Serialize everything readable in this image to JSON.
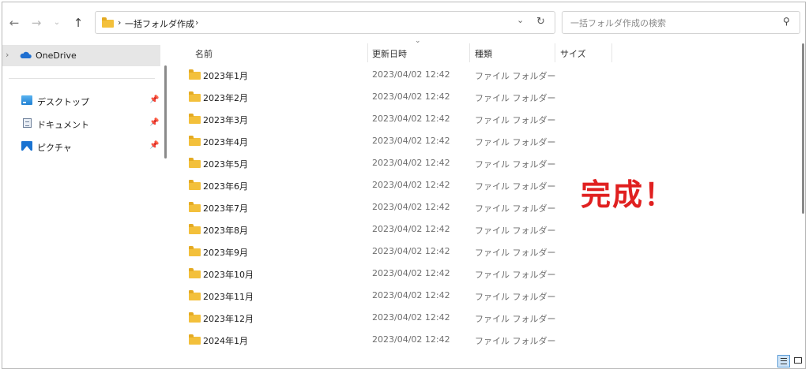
{
  "toolbar": {
    "back_icon": "arrow-left-icon",
    "forward_icon": "arrow-right-icon",
    "recent_icon": "chevron-down-icon",
    "up_icon": "arrow-up-icon"
  },
  "address_bar": {
    "breadcrumb": "一括フォルダ作成",
    "separator": "›"
  },
  "search": {
    "placeholder": "一括フォルダ作成の検索"
  },
  "nav_pane": {
    "onedrive": "OneDrive",
    "quick_access": [
      {
        "label": "デスクトップ",
        "icon": "desktop-icon"
      },
      {
        "label": "ドキュメント",
        "icon": "documents-icon"
      },
      {
        "label": "ピクチャ",
        "icon": "pictures-icon"
      }
    ]
  },
  "columns": {
    "name": "名前",
    "date": "更新日時",
    "type": "種類",
    "size": "サイズ"
  },
  "rows": [
    {
      "name": "2023年1月",
      "date": "2023/04/02 12:42",
      "type": "ファイル フォルダー"
    },
    {
      "name": "2023年2月",
      "date": "2023/04/02 12:42",
      "type": "ファイル フォルダー"
    },
    {
      "name": "2023年3月",
      "date": "2023/04/02 12:42",
      "type": "ファイル フォルダー"
    },
    {
      "name": "2023年4月",
      "date": "2023/04/02 12:42",
      "type": "ファイル フォルダー"
    },
    {
      "name": "2023年5月",
      "date": "2023/04/02 12:42",
      "type": "ファイル フォルダー"
    },
    {
      "name": "2023年6月",
      "date": "2023/04/02 12:42",
      "type": "ファイル フォルダー"
    },
    {
      "name": "2023年7月",
      "date": "2023/04/02 12:42",
      "type": "ファイル フォルダー"
    },
    {
      "name": "2023年8月",
      "date": "2023/04/02 12:42",
      "type": "ファイル フォルダー"
    },
    {
      "name": "2023年9月",
      "date": "2023/04/02 12:42",
      "type": "ファイル フォルダー"
    },
    {
      "name": "2023年10月",
      "date": "2023/04/02 12:42",
      "type": "ファイル フォルダー"
    },
    {
      "name": "2023年11月",
      "date": "2023/04/02 12:42",
      "type": "ファイル フォルダー"
    },
    {
      "name": "2023年12月",
      "date": "2023/04/02 12:42",
      "type": "ファイル フォルダー"
    },
    {
      "name": "2024年1月",
      "date": "2023/04/02 12:42",
      "type": "ファイル フォルダー"
    }
  ],
  "annotation": "完成！",
  "colors": {
    "annotation": "#e02020",
    "folder": "#f3c03b",
    "selected_nav": "#e6e6e6"
  }
}
